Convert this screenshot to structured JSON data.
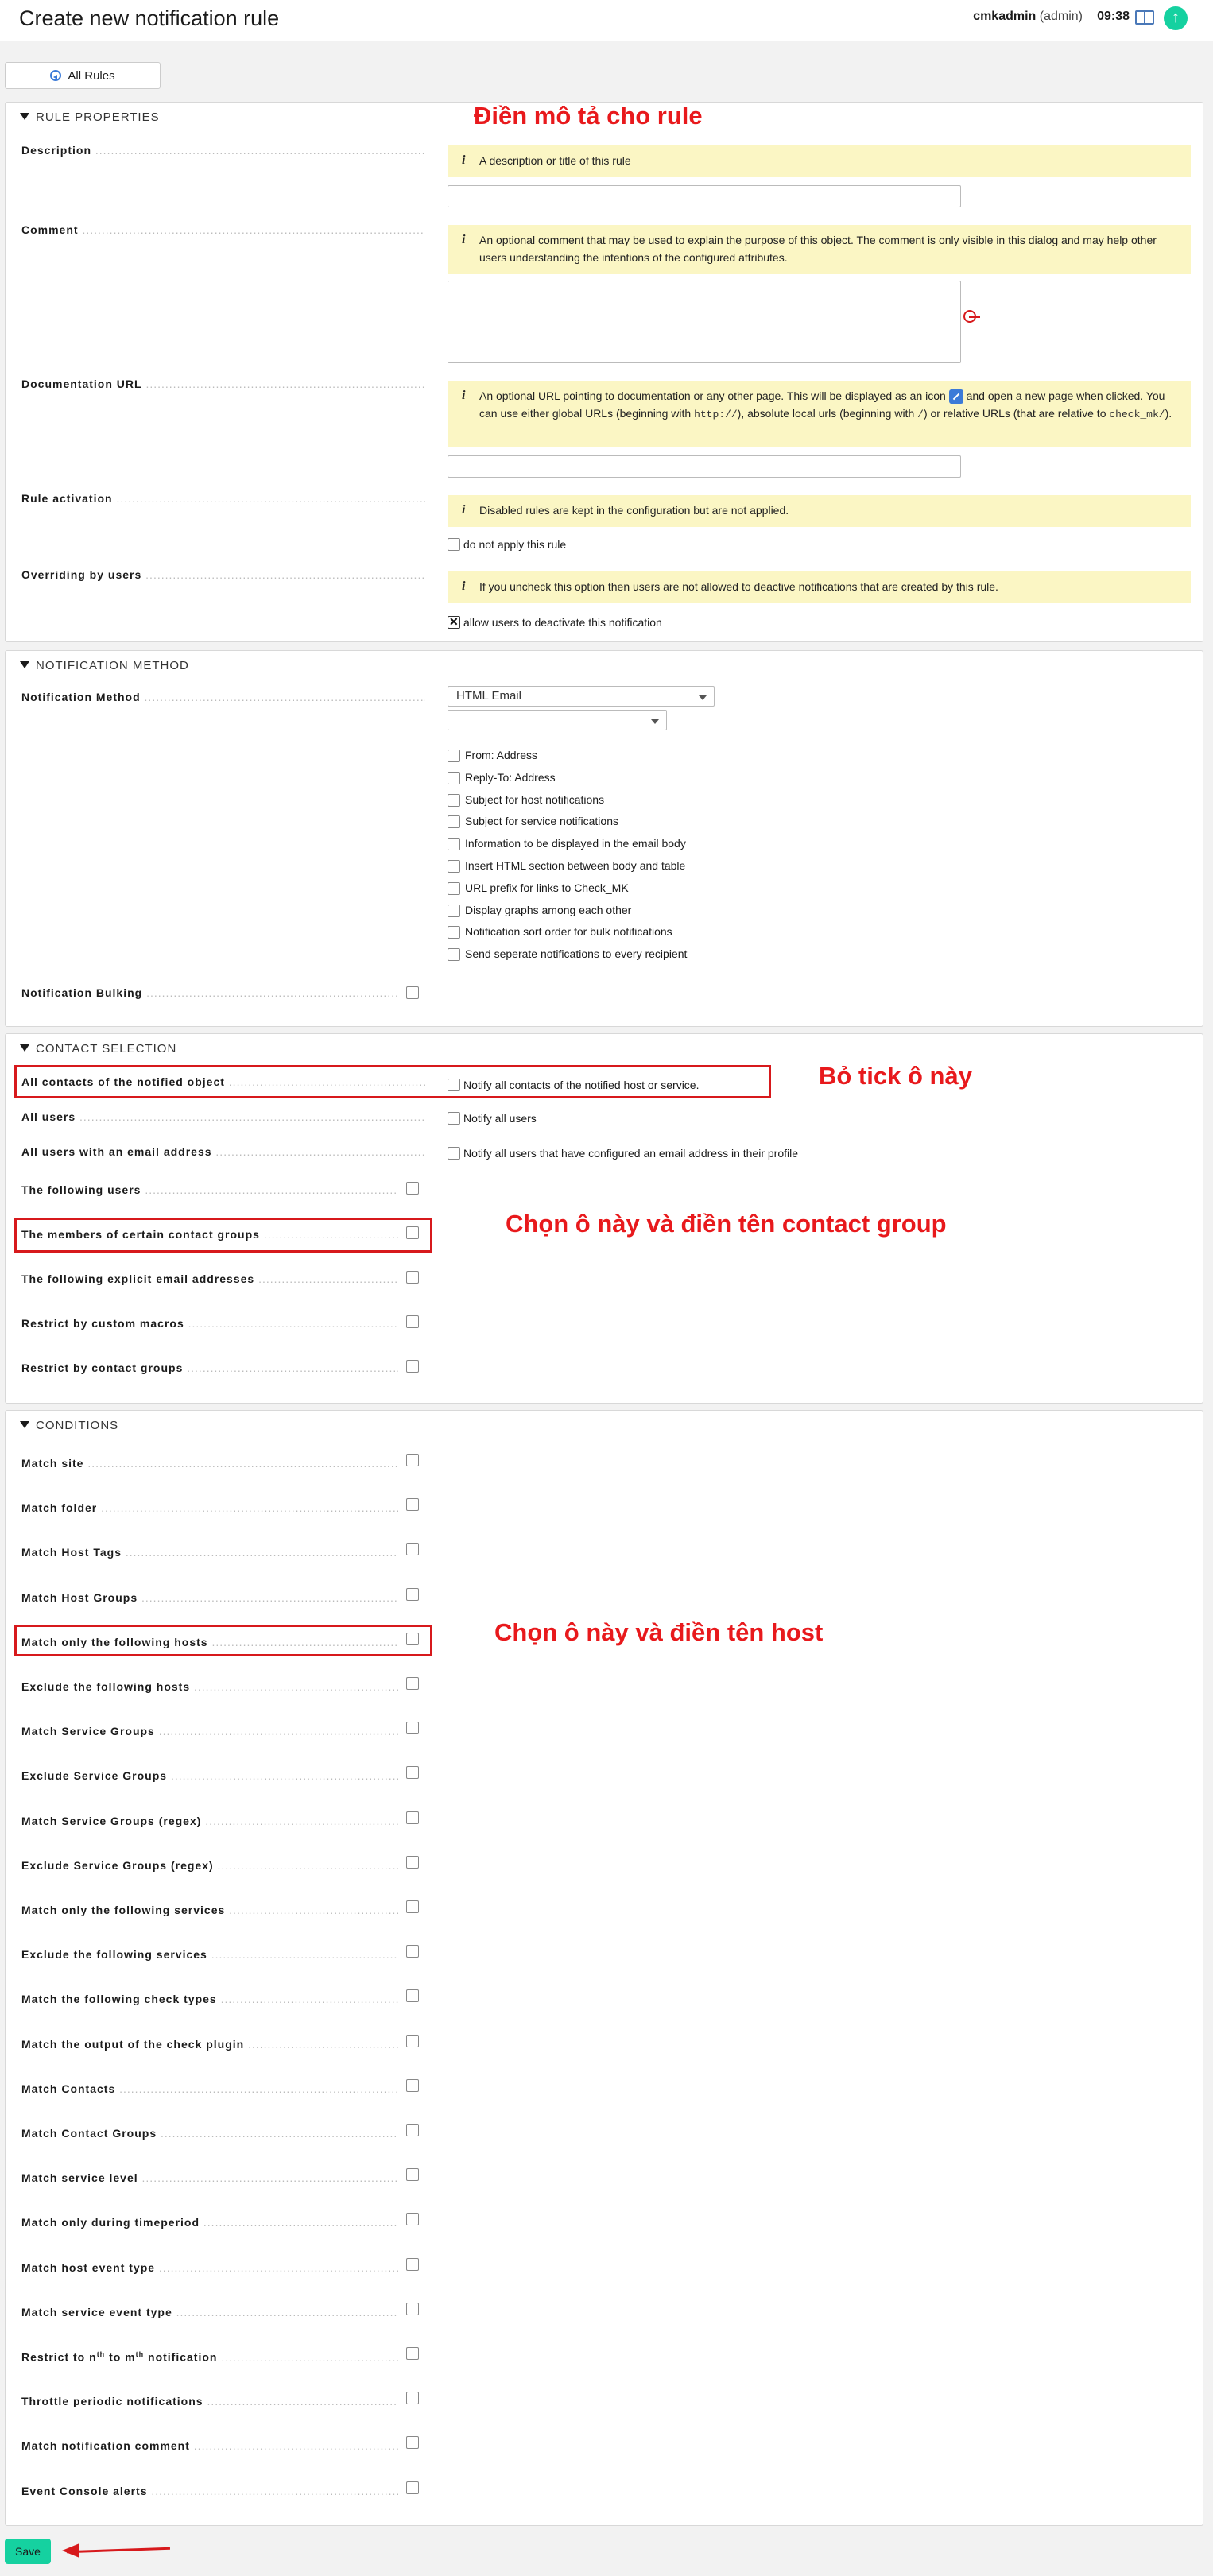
{
  "header": {
    "title": "Create new notification rule",
    "user": "cmkadmin",
    "role": "(admin)",
    "time": "09:38",
    "icons": [
      "book-icon",
      "update-arrow-icon"
    ]
  },
  "toolbar": {
    "all_rules_label": "All Rules"
  },
  "rule_properties": {
    "heading": "RULE PROPERTIES",
    "description_label": "Description",
    "description_help": "A description or title of this rule",
    "description_value": "",
    "comment_label": "Comment",
    "comment_help": "An optional comment that may be used to explain the purpose of this object. The comment is only visible in this dialog and may help other users understanding the intentions of the configured attributes.",
    "comment_value": "",
    "doc_url_label": "Documentation URL",
    "doc_help_1": "An optional URL pointing to documentation or any other page. This will be displayed as an icon",
    "doc_help_2": "and open a new page when clicked. You can use either global URLs (beginning with",
    "doc_help_code_http": "http://",
    "doc_help_3": "), absolute local urls (beginning with",
    "doc_help_code_slash": "/",
    "doc_help_4": ") or relative URLs (that are relative to",
    "doc_help_code_checkmk": "check_mk/",
    "doc_help_5": ").",
    "doc_url_value": "",
    "activation_label": "Rule activation",
    "activation_help": "Disabled rules are kept in the configuration but are not applied.",
    "activation_checkbox": "do not apply this rule",
    "activation_checked": false,
    "overriding_label": "Overriding by users",
    "overriding_help": "If you uncheck this option then users are not allowed to deactive notifications that are created by this rule.",
    "overriding_checkbox": "allow users to deactivate this notification",
    "overriding_checked": true
  },
  "notification_method": {
    "heading": "NOTIFICATION METHOD",
    "method_label": "Notification Method",
    "method_selected": "HTML Email",
    "second_select_value": "",
    "options": [
      "From: Address",
      "Reply-To: Address",
      "Subject for host notifications",
      "Subject for service notifications",
      "Information to be displayed in the email body",
      "Insert HTML section between body and table",
      "URL prefix for links to Check_MK",
      "Display graphs among each other",
      "Notification sort order for bulk notifications",
      "Send seperate notifications to every recipient"
    ],
    "bulking_label": "Notification Bulking"
  },
  "contact_selection": {
    "heading": "CONTACT SELECTION",
    "all_contacts_label": "All contacts of the notified object",
    "all_contacts_option": "Notify all contacts of the notified host or service.",
    "all_users_label": "All users",
    "all_users_option": "Notify all users",
    "email_users_label": "All users with an email address",
    "email_users_option": "Notify all users that have configured an email address in their profile",
    "rows": [
      "The following users",
      "The members of certain contact groups",
      "The following explicit email addresses",
      "Restrict by custom macros",
      "Restrict by contact groups"
    ]
  },
  "conditions": {
    "heading": "CONDITIONS",
    "rows": [
      "Match site",
      "Match folder",
      "Match Host Tags",
      "Match Host Groups",
      "Match only the following hosts",
      "Exclude the following hosts",
      "Match Service Groups",
      "Exclude Service Groups",
      "Match Service Groups (regex)",
      "Exclude Service Groups (regex)",
      "Match only the following services",
      "Exclude the following services",
      "Match the following check types",
      "Match the output of the check plugin",
      "Match Contacts",
      "Match Contact Groups",
      "Match service level",
      "Match only during timeperiod",
      "Match host event type",
      "Match service event type",
      "Restrict to nth to mth notification",
      "Throttle periodic notifications",
      "Match notification comment",
      "Event Console alerts"
    ],
    "restrict_prefix": "Restrict to n",
    "restrict_sup1": "th",
    "restrict_mid": " to m",
    "restrict_sup2": "th",
    "restrict_suffix": " notification"
  },
  "annotations": {
    "description": "Điền mô tả cho rule",
    "untick": "Bỏ tick ô này",
    "contact_group": "Chọn ô này và điền tên contact group",
    "host": "Chọn ô này và điền tên host"
  },
  "footer": {
    "save_label": "Save"
  },
  "colors": {
    "accent": "#15d1a0",
    "help_bg": "#fbf6c4",
    "annotation": "#e8191c"
  }
}
